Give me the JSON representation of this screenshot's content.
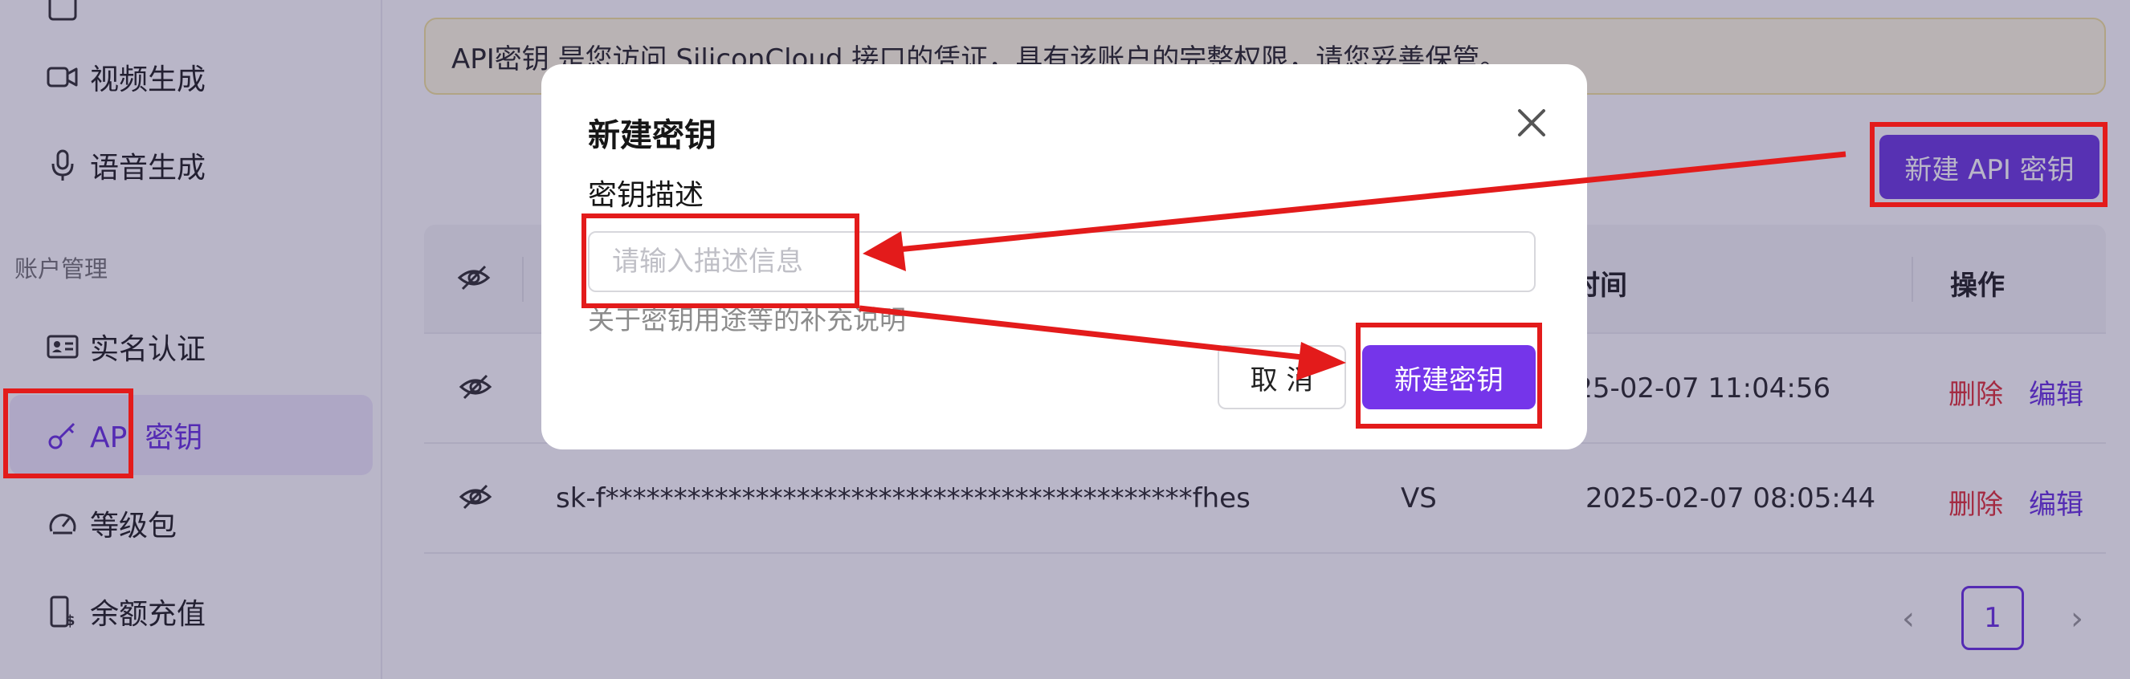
{
  "sidebar": {
    "items_top": [
      {
        "label": "视频生成",
        "icon": "video-camera-icon"
      },
      {
        "label": "语音生成",
        "icon": "microphone-icon"
      }
    ],
    "section_title": "账户管理",
    "items": [
      {
        "label": "实名认证",
        "icon": "id-card-icon"
      },
      {
        "label": "API 密钥",
        "icon": "key-icon",
        "active": true
      },
      {
        "label": "等级包",
        "icon": "gauge-icon"
      },
      {
        "label": "余额充值",
        "icon": "phone-dollar-icon"
      }
    ]
  },
  "main": {
    "notice": "API密钥 是您访问 SiliconCloud 接口的凭证，具有该账户的完整权限，请您妥善保管。",
    "new_key_button": "新建 API 密钥",
    "table": {
      "headers": {
        "created_partial": "建时间",
        "actions": "操作"
      },
      "rows": [
        {
          "key": "",
          "description": "",
          "created": "2025-02-07 11:04:56",
          "delete": "删除",
          "edit": "编辑"
        },
        {
          "key": "sk-f*******************************************fhes",
          "description": "VS",
          "created": "2025-02-07 08:05:44",
          "delete": "删除",
          "edit": "编辑"
        }
      ]
    },
    "pagination": {
      "current_page": "1",
      "prev": "‹",
      "next": "›"
    }
  },
  "modal": {
    "title": "新建密钥",
    "field_label": "密钥描述",
    "input_value": "",
    "input_placeholder": "请输入描述信息",
    "help_text": "关于密钥用途等的补充说明",
    "cancel_label": "取 消",
    "create_label": "新建密钥",
    "close_icon": "close-icon"
  },
  "annotations": {
    "color": "#e31b1b"
  },
  "colors": {
    "brand": "#6f3be0",
    "notice_bg": "#fffbe2",
    "danger": "#e0333a"
  }
}
